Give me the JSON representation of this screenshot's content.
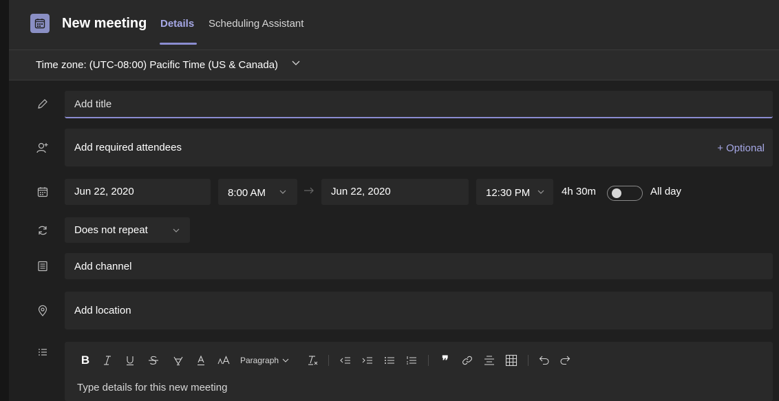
{
  "header": {
    "title": "New meeting",
    "tabs": [
      {
        "label": "Details",
        "active": true
      },
      {
        "label": "Scheduling Assistant",
        "active": false
      }
    ],
    "icon": "calendar-icon"
  },
  "timezone": {
    "label": "Time zone: (UTC-08:00) Pacific Time (US & Canada)"
  },
  "form": {
    "title_placeholder": "Add title",
    "attendees_placeholder": "Add required attendees",
    "optional_label": "+ Optional",
    "start_date": "Jun 22, 2020",
    "start_time": "8:00 AM",
    "end_date": "Jun 22, 2020",
    "end_time": "12:30 PM",
    "duration": "4h 30m",
    "all_day_label": "All day",
    "all_day_on": false,
    "repeat": "Does not repeat",
    "channel_placeholder": "Add channel",
    "location_placeholder": "Add location",
    "details_placeholder": "Type details for this new meeting"
  },
  "toolbar": {
    "paragraph_label": "Paragraph",
    "items": [
      "bold-icon",
      "italic-icon",
      "underline-icon",
      "strikethrough-icon",
      "highlight-icon",
      "font-color-icon",
      "font-size-icon",
      "paragraph-dropdown",
      "clear-format-icon",
      "decrease-indent-icon",
      "increase-indent-icon",
      "bulleted-list-icon",
      "numbered-list-icon",
      "quote-icon",
      "link-icon",
      "align-icon",
      "table-icon",
      "undo-icon",
      "redo-icon"
    ]
  },
  "colors": {
    "accent": "#8b8cd1",
    "background": "#1f1f1f",
    "field": "#292929"
  }
}
